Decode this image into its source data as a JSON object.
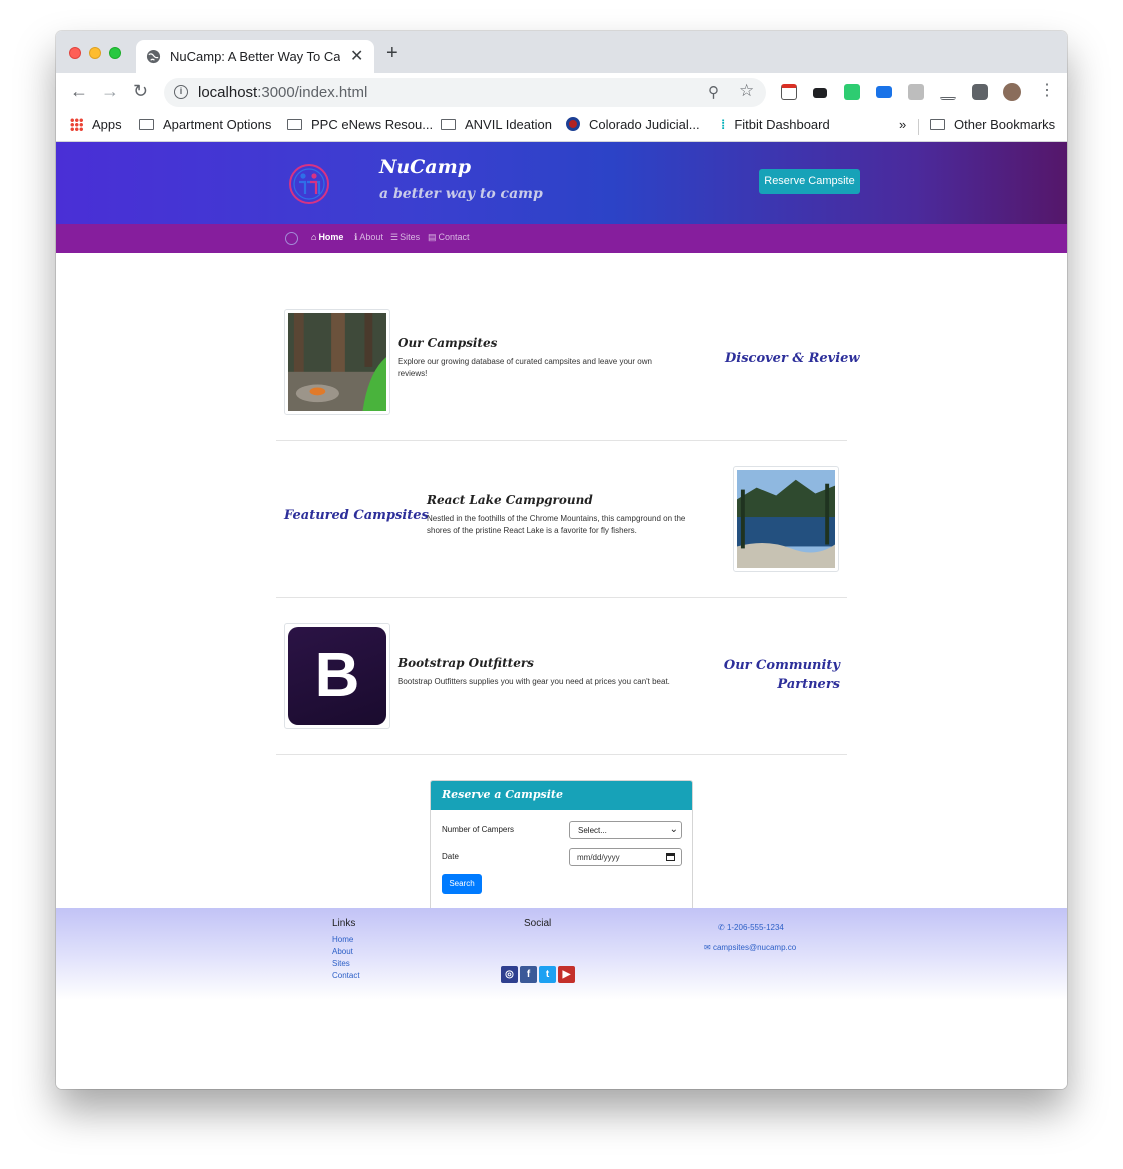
{
  "browser": {
    "tab_title": "NuCamp: A Better Way To Camp",
    "close_glyph": "✕",
    "new_tab_glyph": "+",
    "url_host": "localhost",
    "url_rest": ":3000/index.html",
    "back_glyph": "←",
    "forward_glyph": "→",
    "reload_glyph": "↻",
    "zoom_glyph": "⚲",
    "star_glyph": "☆",
    "menu_glyph": "⋮"
  },
  "bookmarks": {
    "items": [
      "Apps",
      "Apartment Options",
      "PPC eNews Resou...",
      "ANVIL Ideation",
      "Colorado Judicial...",
      "Fitbit Dashboard"
    ],
    "overflow": "»",
    "other": "Other Bookmarks"
  },
  "header": {
    "brand": "NuCamp",
    "tagline": "a better way to camp",
    "reserve_button": "Reserve Campsite"
  },
  "nav": {
    "items": [
      {
        "label": "Home",
        "icon": "home-icon",
        "glyph": "⌂"
      },
      {
        "label": "About",
        "icon": "info-icon",
        "glyph": "ℹ"
      },
      {
        "label": "Sites",
        "icon": "list-icon",
        "glyph": "☰"
      },
      {
        "label": "Contact",
        "icon": "address-card-icon",
        "glyph": "▤"
      }
    ]
  },
  "sections": [
    {
      "heading": "Discover & Review",
      "title": "Our Campsites",
      "text": "Explore our growing database of curated campsites and leave your own reviews!"
    },
    {
      "heading": "Featured Campsites",
      "title": "React Lake Campground",
      "text": "Nestled in the foothills of the Chrome Mountains, this campground on the shores of the pristine React Lake is a favorite for fly fishers."
    },
    {
      "heading": "Our Community Partners",
      "title": "Bootstrap Outfitters",
      "text": "Bootstrap Outfitters supplies you with gear you need at prices you can't beat.",
      "logo_letter": "B"
    }
  ],
  "reserve": {
    "title": "Reserve a Campsite",
    "campers_label": "Number of Campers",
    "campers_value": "Select...",
    "date_label": "Date",
    "date_placeholder": "mm/dd/yyyy",
    "search_button": "Search"
  },
  "footer": {
    "links_heading": "Links",
    "links": [
      "Home",
      "About",
      "Sites",
      "Contact"
    ],
    "social_heading": "Social",
    "social": [
      {
        "icon": "instagram-icon",
        "glyph": "◎",
        "color": "#2f3f8f"
      },
      {
        "icon": "facebook-icon",
        "glyph": "f",
        "color": "#3b5998"
      },
      {
        "icon": "twitter-icon",
        "glyph": "t",
        "color": "#1da1f2"
      },
      {
        "icon": "youtube-icon",
        "glyph": "▶",
        "color": "#c4302b"
      }
    ],
    "phone": "1-206-555-1234",
    "email": "campsites@nucamp.co",
    "phone_glyph": "✆",
    "email_glyph": "✉"
  },
  "colors": {
    "accent": "#17a2b8",
    "nav_bg": "#861e9d",
    "heading": "#2d2f9a",
    "primary_button": "#007bff"
  }
}
